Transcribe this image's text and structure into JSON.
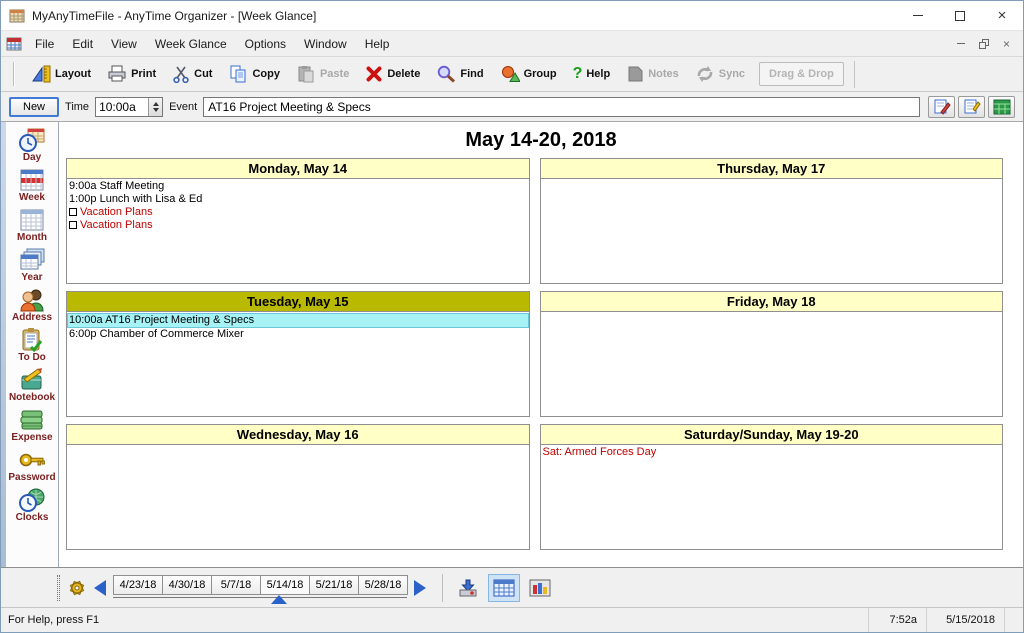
{
  "window": {
    "title": "MyAnyTimeFile - AnyTime Organizer - [Week Glance]"
  },
  "menu": {
    "items": [
      {
        "label": "File"
      },
      {
        "label": "Edit"
      },
      {
        "label": "View"
      },
      {
        "label": "Week Glance"
      },
      {
        "label": "Options"
      },
      {
        "label": "Window"
      },
      {
        "label": "Help"
      }
    ]
  },
  "toolbar": {
    "buttons": [
      {
        "label": "Layout",
        "enabled": true
      },
      {
        "label": "Print",
        "enabled": true
      },
      {
        "label": "Cut",
        "enabled": true
      },
      {
        "label": "Copy",
        "enabled": true
      },
      {
        "label": "Paste",
        "enabled": false
      },
      {
        "label": "Delete",
        "enabled": true
      },
      {
        "label": "Find",
        "enabled": true
      },
      {
        "label": "Group",
        "enabled": true
      },
      {
        "label": "Help",
        "enabled": true
      },
      {
        "label": "Notes",
        "enabled": false
      },
      {
        "label": "Sync",
        "enabled": false
      }
    ],
    "dragdrop_label": "Drag & Drop"
  },
  "entry": {
    "new_label": "New",
    "time_label": "Time",
    "time_value": "10:00a",
    "event_label": "Event",
    "event_value": "AT16 Project Meeting & Specs"
  },
  "sidebar": {
    "items": [
      {
        "label": "Day"
      },
      {
        "label": "Week"
      },
      {
        "label": "Month"
      },
      {
        "label": "Year"
      },
      {
        "label": "Address"
      },
      {
        "label": "To Do"
      },
      {
        "label": "Notebook"
      },
      {
        "label": "Expense"
      },
      {
        "label": "Password"
      },
      {
        "label": "Clocks"
      }
    ]
  },
  "calendar": {
    "title": "May 14-20, 2018",
    "panels": [
      {
        "header": "Monday, May 14",
        "events": [
          {
            "text": "9:00a Staff Meeting"
          },
          {
            "text": "1:00p Lunch with Lisa & Ed"
          },
          {
            "text": "Vacation Plans"
          },
          {
            "text": "Vacation Plans"
          }
        ]
      },
      {
        "header": "Tuesday, May 15",
        "events": [
          {
            "text": "10:00a AT16 Project Meeting & Specs"
          },
          {
            "text": "6:00p Chamber of Commerce Mixer"
          }
        ]
      },
      {
        "header": "Wednesday, May 16",
        "events": []
      },
      {
        "header": "Thursday, May 17",
        "events": []
      },
      {
        "header": "Friday, May 18",
        "events": []
      },
      {
        "header": "Saturday/Sunday, May 19-20",
        "events": [
          {
            "text": "Sat: Armed Forces Day"
          }
        ]
      }
    ]
  },
  "weekbar": {
    "tabs": [
      {
        "label": "4/23/18"
      },
      {
        "label": "4/30/18"
      },
      {
        "label": "5/7/18"
      },
      {
        "label": "5/14/18"
      },
      {
        "label": "5/21/18"
      },
      {
        "label": "5/28/18"
      }
    ],
    "active_index": 3
  },
  "statusbar": {
    "help_text": "For Help, press F1",
    "time": "7:52a",
    "date": "5/15/2018"
  },
  "colors": {
    "header_yellow": "#ffffc6",
    "today_olive": "#b9b900",
    "selection_cyan": "#a6f2f4",
    "event_red": "#c00000",
    "sidebar_label_maroon": "#7b2121",
    "accent_blue": "#2b62c9"
  }
}
